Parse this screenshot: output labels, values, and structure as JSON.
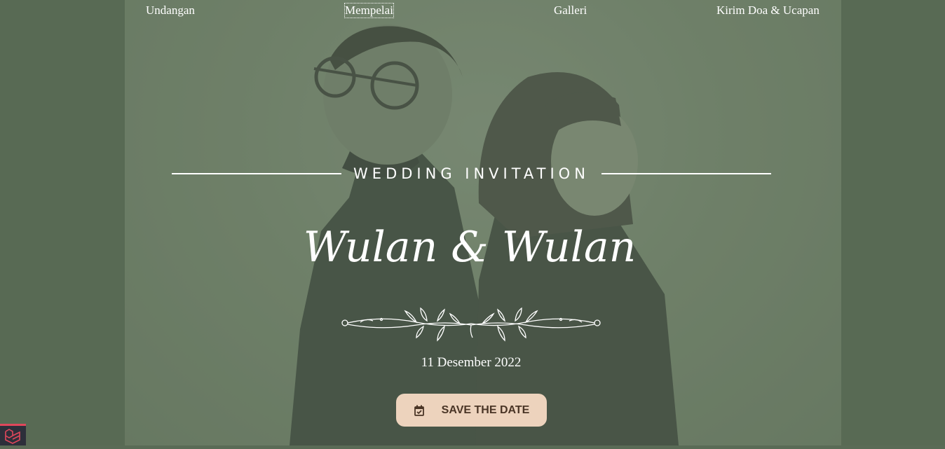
{
  "nav": {
    "items": [
      {
        "label": "Undangan"
      },
      {
        "label": "Mempelai"
      },
      {
        "label": "Galleri"
      },
      {
        "label": "Kirim Doa & Ucapan"
      }
    ]
  },
  "hero": {
    "subtitle": "WEDDING INVITATION",
    "names": "Wulan & Wulan",
    "date": "11 Desember 2022",
    "save_button": "SAVE THE DATE",
    "save_icon": "calendar-check-icon",
    "ornament_icon": "floral-divider-icon"
  },
  "colors": {
    "page_bg": "#5a6b56",
    "button_bg": "#edd3bd",
    "button_text": "#4a3526",
    "text": "#ffffff",
    "corner_accent": "#e0475b"
  },
  "corner": {
    "icon": "laravel-debugbar-icon"
  }
}
